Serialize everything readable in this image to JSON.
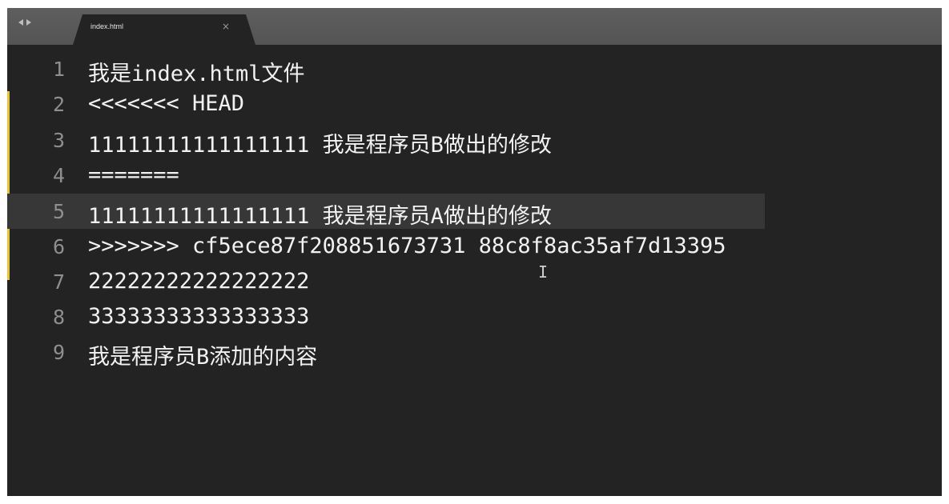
{
  "tab": {
    "filename": "index.html",
    "close_glyph": "×"
  },
  "editor": {
    "lines": [
      {
        "num": "1",
        "text": "我是index.html文件"
      },
      {
        "num": "2",
        "text": "<<<<<<< HEAD"
      },
      {
        "num": "3",
        "text": "11111111111111111 我是程序员B做出的修改"
      },
      {
        "num": "4",
        "text": "======="
      },
      {
        "num": "5",
        "text": "11111111111111111 我是程序员A做出的修改"
      },
      {
        "num": "6",
        "text": ">>>>>>> cf5ece87f208851673731 88c8f8ac35af7d13395"
      },
      {
        "num": "7",
        "text": "22222222222222222"
      },
      {
        "num": "8",
        "text": "33333333333333333"
      },
      {
        "num": "9",
        "text": "我是程序员B添加的内容"
      }
    ],
    "highlighted_line": "5"
  },
  "colors": {
    "editor_bg": "#232323",
    "tabbar_bg": "#595959",
    "text": "#f2f2f2",
    "gutter_text": "#8f8f8f",
    "diff_marker": "#e8c23a",
    "line_highlight": "#373737"
  },
  "icons": {
    "nav_left": "arrow-left-icon",
    "nav_right": "arrow-right-icon",
    "cursor": "text-cursor-icon"
  }
}
